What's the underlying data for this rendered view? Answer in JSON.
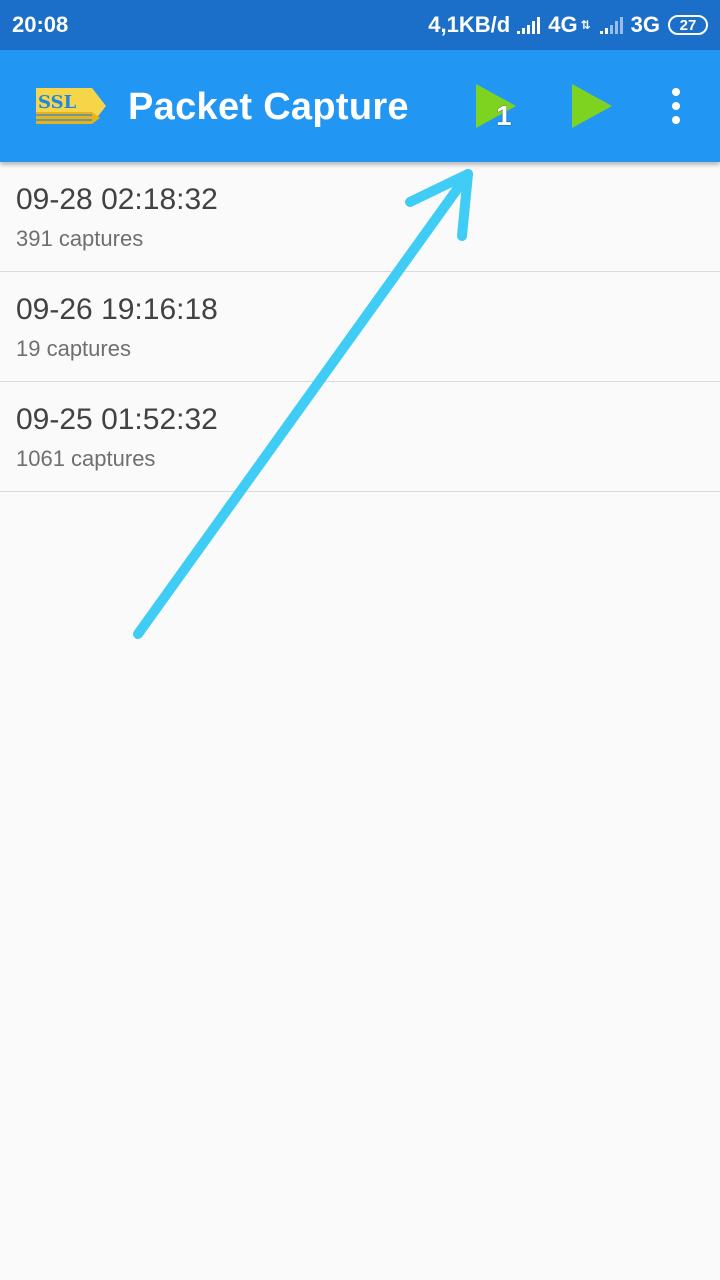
{
  "status_bar": {
    "time": "20:08",
    "speed": "4,1KB/d",
    "network_1": "4G",
    "network_2": "3G",
    "battery": "27"
  },
  "app_bar": {
    "title": "Packet Capture",
    "logo_text": "SSL",
    "color": "#2196f3",
    "play_color": "#7ed321",
    "badge": "1",
    "icons": [
      "ssl-logo-icon",
      "play-ssl-icon",
      "play-icon",
      "more-vert-icon"
    ]
  },
  "sessions": [
    {
      "title": "09-28 02:18:32",
      "subtitle": "391 captures"
    },
    {
      "title": "09-26 19:16:18",
      "subtitle": "19 captures"
    },
    {
      "title": "09-25 01:52:32",
      "subtitle": "1061 captures"
    }
  ],
  "annotation": {
    "color": "#3fcdf5"
  }
}
